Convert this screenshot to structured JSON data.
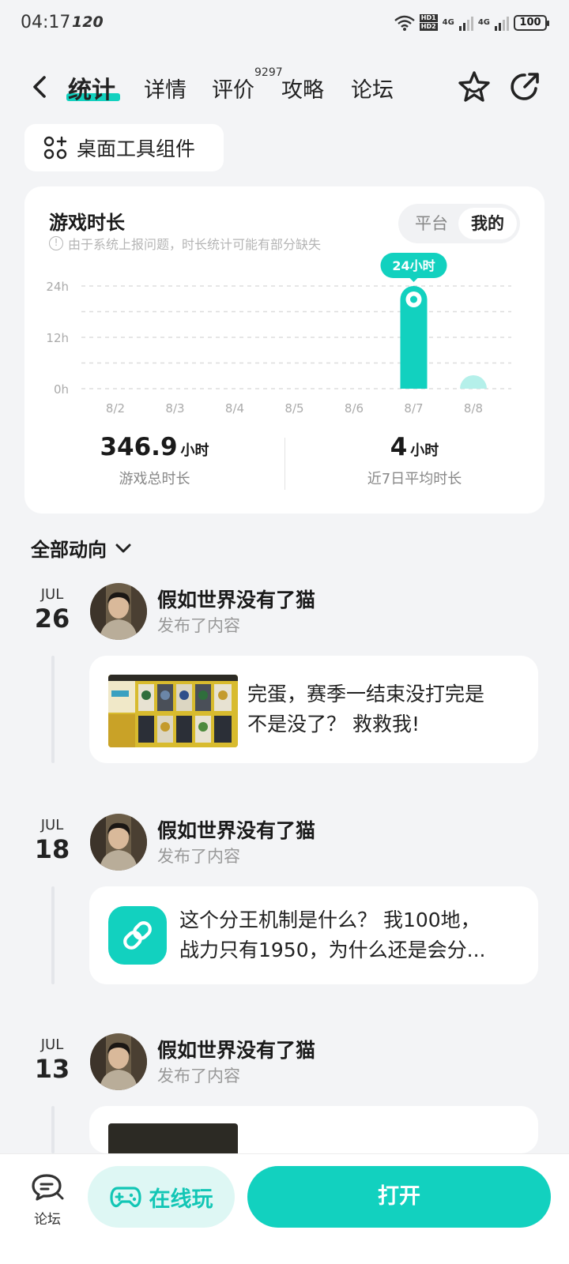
{
  "status_bar": {
    "time": "04:17",
    "refresh": "120",
    "net1": "4G",
    "net2": "4G",
    "hd1": "HD1",
    "hd2": "HD2",
    "battery": "100"
  },
  "nav": {
    "tabs": [
      {
        "label": "统计",
        "active": true
      },
      {
        "label": "详情"
      },
      {
        "label": "评价"
      },
      {
        "label": "攻略"
      },
      {
        "label": "论坛"
      }
    ],
    "review_count": "9297"
  },
  "widget_button": {
    "label": "桌面工具组件"
  },
  "stats": {
    "title": "游戏时长",
    "notice": "由于系统上报问题，时长统计可能有部分缺失",
    "toggle": {
      "options": [
        "平台",
        "我的"
      ],
      "selected": "我的"
    },
    "total": {
      "value": "346.9",
      "unit": "小时",
      "label": "游戏总时长"
    },
    "average": {
      "value": "4",
      "unit": "小时",
      "label": "近7日平均时长"
    }
  },
  "chart_data": {
    "type": "bar",
    "categories": [
      "8/2",
      "8/3",
      "8/4",
      "8/5",
      "8/6",
      "8/7",
      "8/8"
    ],
    "values": [
      0,
      0,
      0,
      0,
      0,
      24,
      0.5
    ],
    "y_ticks": [
      "0h",
      "12h",
      "24h"
    ],
    "ylim": [
      0,
      24
    ],
    "highlight_label": "24小时",
    "highlight_index": 5,
    "grid": true,
    "colors": {
      "bar": "#12d1bf",
      "bar_today": "#b5f0ea",
      "grid": "#dddddd"
    }
  },
  "feed": {
    "filter_label": "全部动向",
    "entries": [
      {
        "month": "JUL",
        "day": "26",
        "author": "假如世界没有了猫",
        "action": "发布了内容",
        "text_line1": "完蛋，赛季一结束没打完是",
        "text_line2": "不是没了？ 救救我!"
      },
      {
        "month": "JUL",
        "day": "18",
        "author": "假如世界没有了猫",
        "action": "发布了内容",
        "text_line1": "这个分王机制是什么？ 我100地，",
        "text_line2": "战力只有1950，为什么还是会分..."
      },
      {
        "month": "JUL",
        "day": "13",
        "author": "假如世界没有了猫",
        "action": "发布了内容"
      }
    ]
  },
  "bottom_bar": {
    "forum_label": "论坛",
    "play_label": "在线玩",
    "open_label": "打开"
  },
  "colors": {
    "accent": "#12d1bf",
    "background": "#f3f4f6"
  }
}
